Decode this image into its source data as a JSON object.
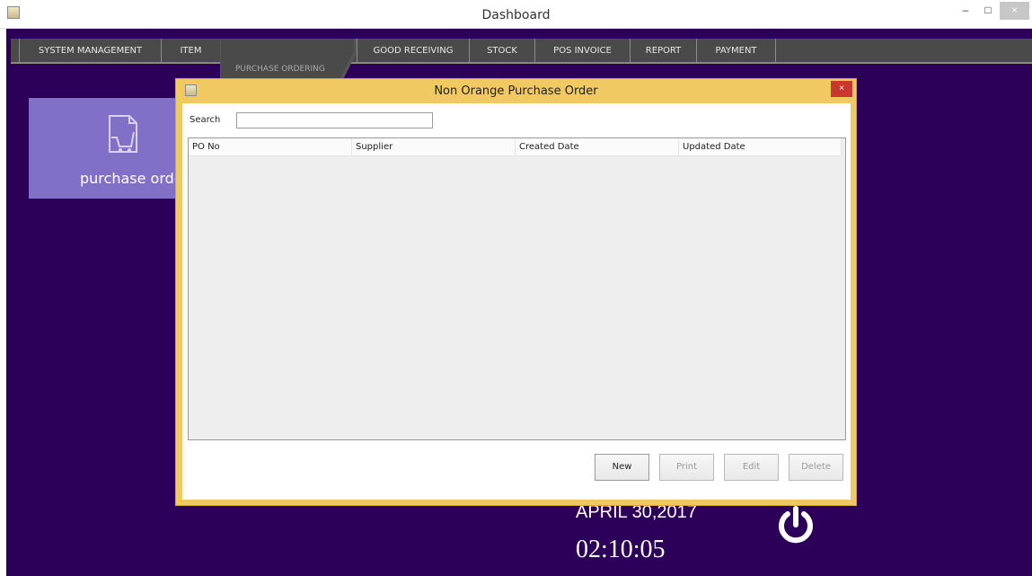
{
  "window": {
    "title": "Dashboard",
    "min_glyph": "–",
    "max_glyph": "□",
    "close_glyph": "×"
  },
  "menu": {
    "items": [
      {
        "label": "SYSTEM MANAGEMENT"
      },
      {
        "label": "ITEM"
      },
      {
        "label": "PURCHASE ORDERING"
      },
      {
        "label": "GOOD RECEIVING"
      },
      {
        "label": "STOCK"
      },
      {
        "label": "POS INVOICE"
      },
      {
        "label": "REPORT"
      },
      {
        "label": "PAYMENT"
      }
    ]
  },
  "tile": {
    "label": "purchase order",
    "icon": "document-cart-icon",
    "color": "#8270c8"
  },
  "dialog": {
    "title": "Non Orange Purchase Order",
    "close_glyph": "×",
    "search_label": "Search",
    "search_value": "",
    "columns": [
      "PO No",
      "Supplier",
      "Created Date",
      "Updated Date"
    ],
    "rows": [],
    "buttons": {
      "new": "New",
      "print": "Print",
      "edit": "Edit",
      "delete": "Delete"
    }
  },
  "footer": {
    "date": "APRIL 30,2017",
    "time": "02:10:05",
    "power_icon": "power-icon"
  },
  "colors": {
    "background": "#2c0059",
    "dialog_frame": "#f1c963",
    "close_red": "#c8382e"
  }
}
